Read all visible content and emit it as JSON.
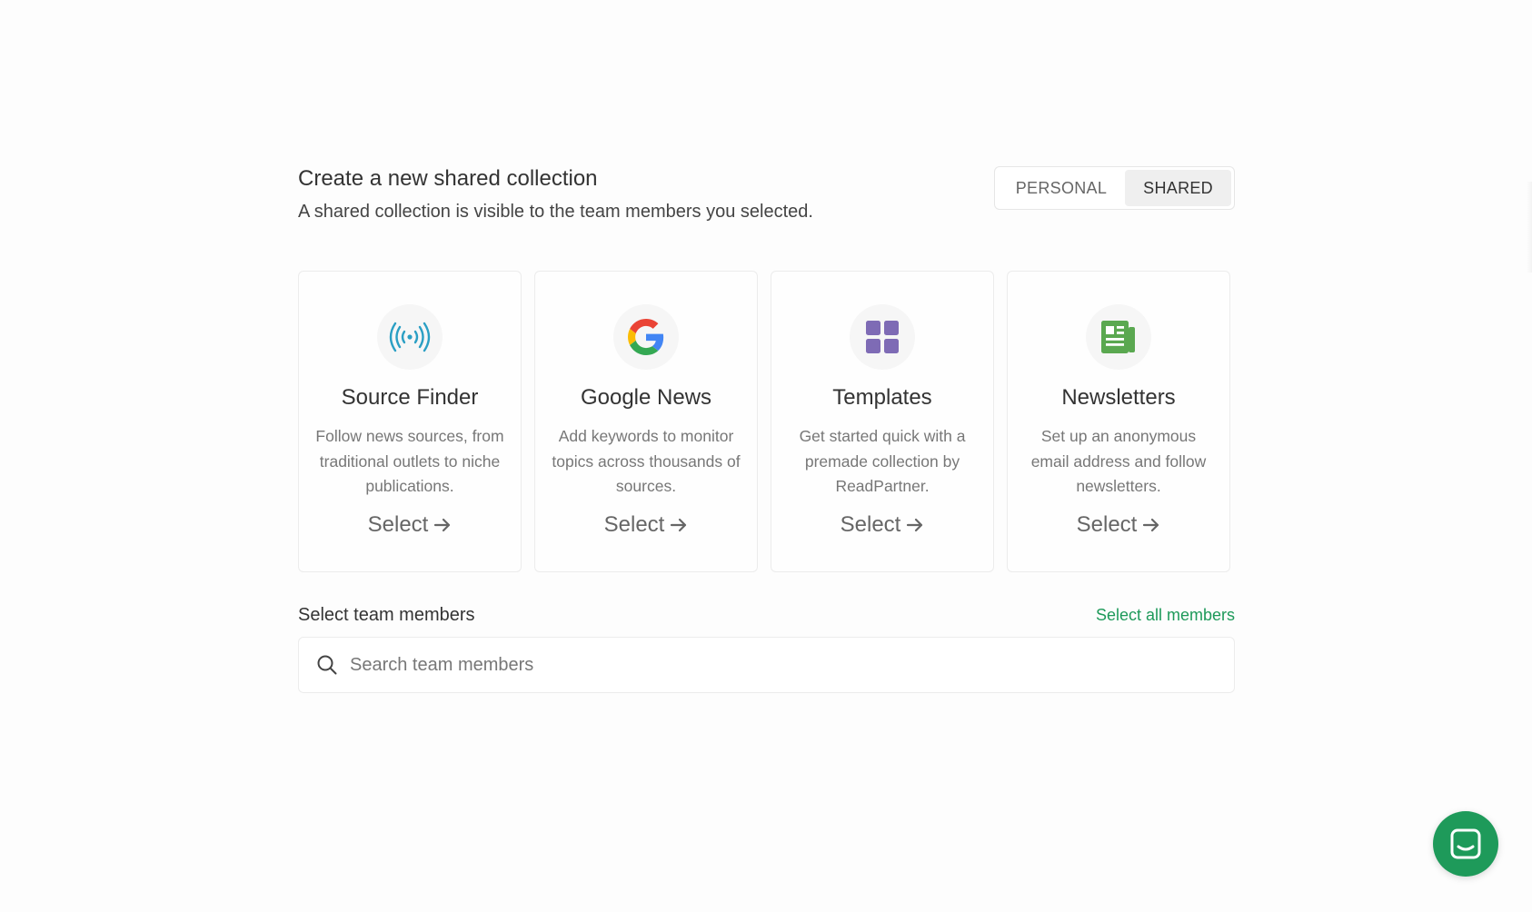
{
  "header": {
    "title": "Create a new shared collection",
    "subtitle": "A shared collection is visible to the team members you selected."
  },
  "toggle": {
    "options": [
      "PERSONAL",
      "SHARED"
    ],
    "selected": "SHARED"
  },
  "cards": [
    {
      "icon": "broadcast-icon",
      "title": "Source Finder",
      "description": "Follow news sources, from traditional outlets to niche publications.",
      "action": "Select"
    },
    {
      "icon": "google-icon",
      "title": "Google News",
      "description": "Add keywords to monitor topics across thousands of sources.",
      "action": "Select"
    },
    {
      "icon": "grid-icon",
      "title": "Templates",
      "description": "Get started quick with a premade collection by ReadPartner.",
      "action": "Select"
    },
    {
      "icon": "newspaper-icon",
      "title": "Newsletters",
      "description": "Set up an anonymous email address and follow newsletters.",
      "action": "Select"
    }
  ],
  "members": {
    "label": "Select team members",
    "select_all": "Select all members",
    "search_placeholder": "Search team members",
    "search_value": ""
  },
  "colors": {
    "accent": "#1e9a5a",
    "broadcast_icon": "#2a9fc4",
    "templates_icon": "#7e6bb5",
    "newsletters_icon": "#5aa850"
  },
  "chat": {
    "icon": "chat-icon"
  }
}
